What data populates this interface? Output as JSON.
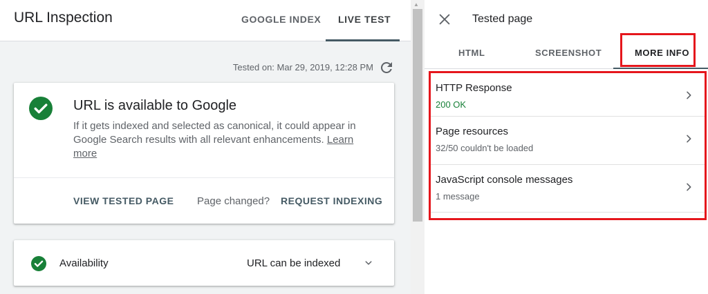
{
  "left": {
    "title": "URL Inspection",
    "tabs": [
      {
        "label": "GOOGLE INDEX",
        "active": false
      },
      {
        "label": "LIVE TEST",
        "active": true
      }
    ],
    "tested_on": "Tested on: Mar 29, 2019, 12:28 PM",
    "result_card": {
      "title": "URL is available to Google",
      "description": "If it gets indexed and selected as canonical, it could appear in Google Search results with all relevant enhancements.",
      "learn_more": "Learn more",
      "view_tested_page": "VIEW TESTED PAGE",
      "page_changed": "Page changed?",
      "request_indexing": "REQUEST INDEXING"
    },
    "availability": {
      "label": "Availability",
      "value": "URL can be indexed"
    }
  },
  "right": {
    "title": "Tested page",
    "tabs": [
      {
        "label": "HTML",
        "active": false
      },
      {
        "label": "SCREENSHOT",
        "active": false
      },
      {
        "label": "MORE INFO",
        "active": true
      }
    ],
    "items": [
      {
        "title": "HTTP Response",
        "subtitle": "200 OK"
      },
      {
        "title": "Page resources",
        "subtitle": "32/50 couldn't be loaded"
      },
      {
        "title": "JavaScript console messages",
        "subtitle": "1 message"
      }
    ]
  },
  "colors": {
    "success_green": "#188038",
    "highlight_red": "#e5161c",
    "tab_accent": "#455a64",
    "background_gray": "#f1f3f4"
  },
  "icons": [
    "refresh-icon",
    "check-circle-icon",
    "chevron-down-icon",
    "close-icon",
    "chevron-right-icon"
  ]
}
